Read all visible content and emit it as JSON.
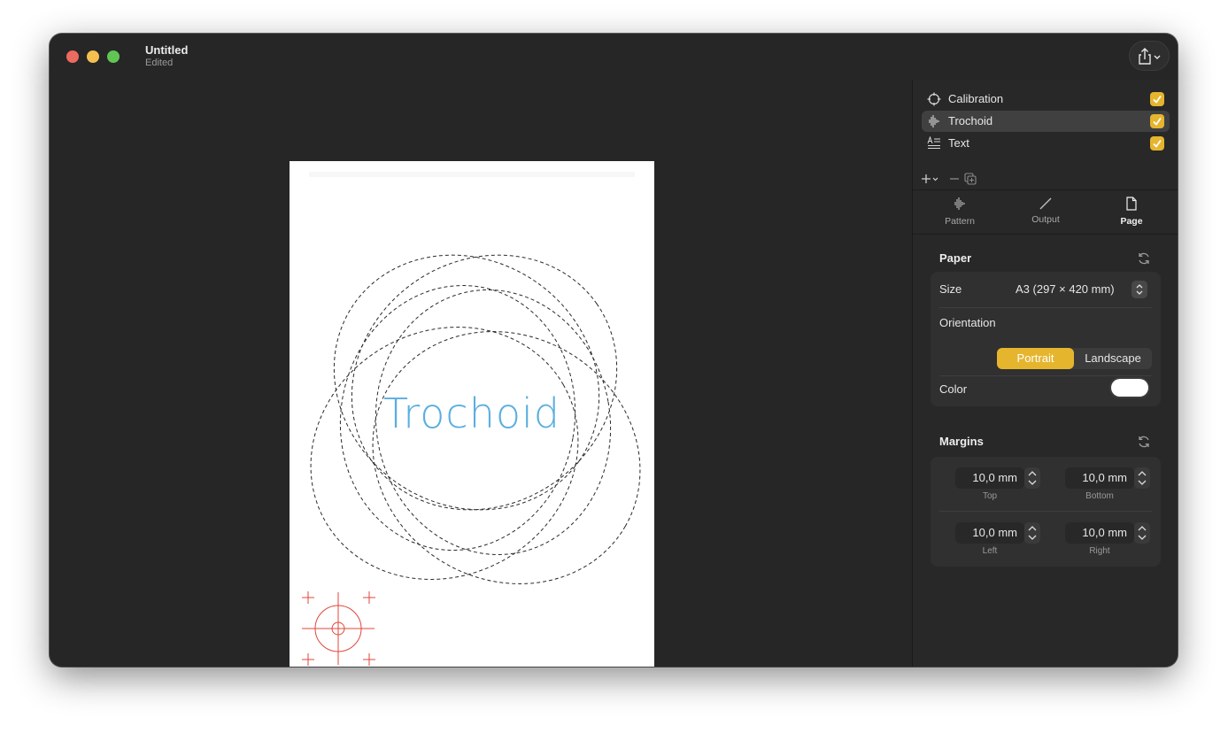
{
  "window": {
    "title": "Untitled",
    "subtitle": "Edited"
  },
  "toolbar": {
    "share_icon": "share-icon"
  },
  "page": {
    "title_text": "Trochoid",
    "title_color": "#5aaee0",
    "calibration_color": "#e0453a"
  },
  "layers": [
    {
      "label": "Calibration",
      "icon": "crosshair-icon",
      "checked": true
    },
    {
      "label": "Trochoid",
      "icon": "waveform-icon",
      "checked": true,
      "selected": true
    },
    {
      "label": "Text",
      "icon": "text-format-icon",
      "checked": true
    }
  ],
  "tabs": [
    {
      "label": "Pattern",
      "icon": "waveform-icon"
    },
    {
      "label": "Output",
      "icon": "pen-icon"
    },
    {
      "label": "Page",
      "icon": "page-icon",
      "active": true
    }
  ],
  "paper": {
    "heading": "Paper",
    "size_label": "Size",
    "size_value": "A3 (297 × 420 mm)",
    "orientation_label": "Orientation",
    "orientation_options": [
      "Portrait",
      "Landscape"
    ],
    "orientation_selected": "Portrait",
    "color_label": "Color",
    "color_value": "#ffffff"
  },
  "margins": {
    "heading": "Margins",
    "top": {
      "value": "10,0 mm",
      "caption": "Top"
    },
    "bottom": {
      "value": "10,0 mm",
      "caption": "Bottom"
    },
    "left": {
      "value": "10,0 mm",
      "caption": "Left"
    },
    "right": {
      "value": "10,0 mm",
      "caption": "Right"
    }
  },
  "accent_color": "#e6b52e"
}
